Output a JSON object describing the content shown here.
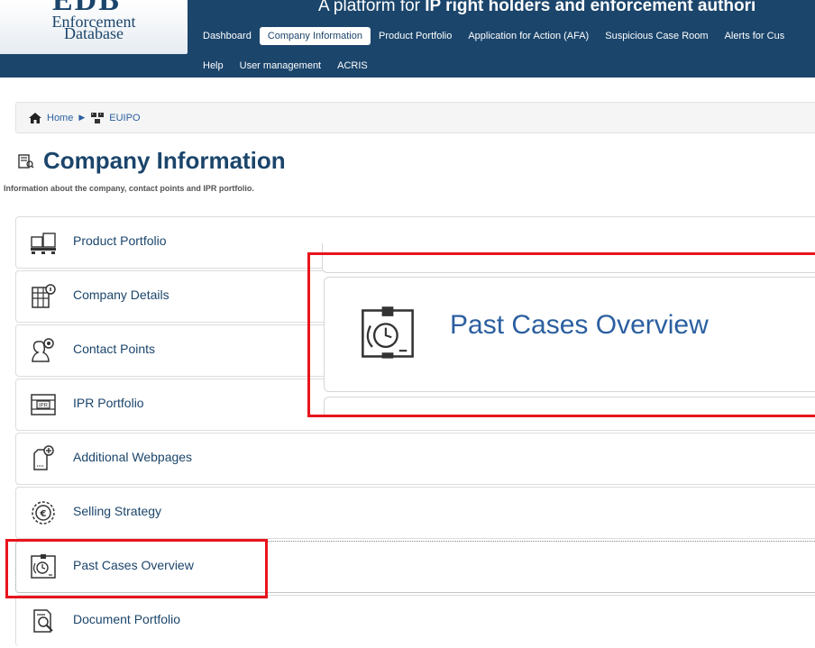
{
  "header": {
    "logo_mark": "EDB",
    "logo_line1": "Enforcement",
    "logo_line2": "Database",
    "tagline_prefix": "A platform for",
    "tagline_bold": "IP right holders and enforcement authori",
    "nav_row1": [
      "Dashboard",
      "Company Information",
      "Product Portfolio",
      "Application for Action (AFA)",
      "Suspicious Case Room",
      "Alerts for Cus"
    ],
    "nav_row2": [
      "Help",
      "User management",
      "ACRIS"
    ],
    "active_nav": "Company Information"
  },
  "breadcrumb": {
    "home": "Home",
    "current": "EUIPO"
  },
  "page": {
    "title": "Company Information",
    "subtitle": "Information about the company, contact points and IPR portfolio."
  },
  "menu": [
    {
      "label": "Product Portfolio",
      "icon": "pallet-boxes-icon"
    },
    {
      "label": "Company Details",
      "icon": "building-info-icon"
    },
    {
      "label": "Contact Points",
      "icon": "contact-person-icon"
    },
    {
      "label": "IPR Portfolio",
      "icon": "ipr-box-icon"
    },
    {
      "label": "Additional Webpages",
      "icon": "webpage-add-icon"
    },
    {
      "label": "Selling Strategy",
      "icon": "euro-coin-icon"
    },
    {
      "label": "Past Cases Overview",
      "icon": "past-cases-clock-icon"
    },
    {
      "label": "Document Portfolio",
      "icon": "document-search-icon"
    }
  ],
  "zoom_callout": {
    "label": "Past Cases Overview",
    "icon": "past-cases-clock-icon"
  },
  "colors": {
    "header_bg": "#1b456b",
    "link": "#1b456b",
    "highlight": "#e8141b"
  }
}
